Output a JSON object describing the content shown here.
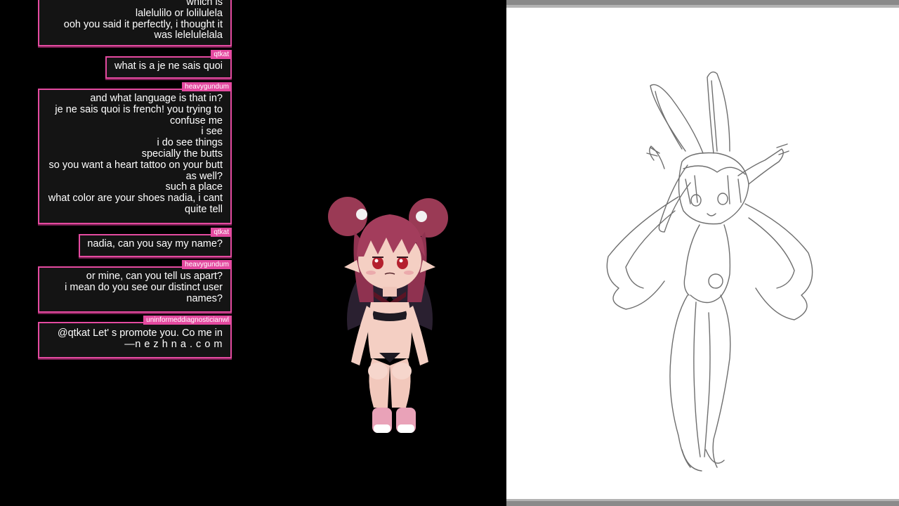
{
  "chat": {
    "messages": [
      {
        "user": "",
        "lines": [
          "which is",
          "lalelulilo or lolilulela",
          "ooh you said it perfectly, i thought it",
          "was lelelulelala"
        ]
      },
      {
        "user": "qtkat",
        "lines": [
          "what is a je ne sais quoi"
        ]
      },
      {
        "user": "heavygundum",
        "lines": [
          "and what language is that in?",
          "je ne sais quoi is french! you trying to",
          "confuse me",
          "i see",
          "i do see things",
          "specially the butts",
          "so you want a heart tattoo on your butt",
          "as well?",
          "such a place",
          "what color are your shoes nadia, i cant",
          "quite tell"
        ]
      },
      {
        "user": "qtkat",
        "lines": [
          "nadia, can you say my name?"
        ]
      },
      {
        "user": "heavygundum",
        "lines": [
          "or mine, can you tell us apart?",
          "i mean do you see our distinct user",
          "names?"
        ]
      },
      {
        "user": "uninformeddiagnosticianwl",
        "lines": [
          "@qtkat Let' s promote you. Co me in",
          "—n e z h n a . c o m"
        ]
      }
    ]
  },
  "colors": {
    "accent": "#e44aa0",
    "bubble_bg": "#141414",
    "canvas_bg": "#ffffff",
    "stream_bg": "#000000"
  },
  "icons": {
    "avatar": "vtuber-avatar-character",
    "sketch": "bunny-girl-sketch"
  }
}
